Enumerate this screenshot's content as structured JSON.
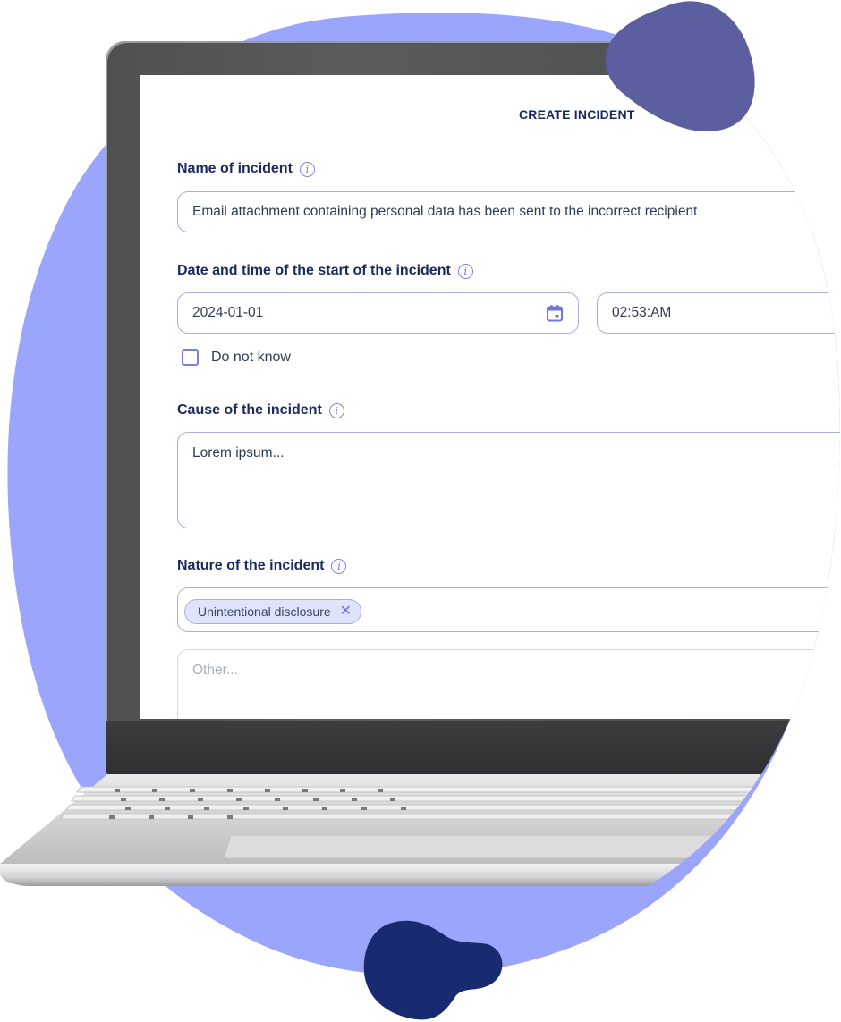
{
  "form": {
    "title": "CREATE INCIDENT",
    "name_field": {
      "label": "Name of incident",
      "value": "Email attachment containing personal data has been sent to the incorrect recipient"
    },
    "datetime_field": {
      "label": "Date and time of the start of the incident",
      "date_value": "2024-01-01",
      "time_value": "02:53:AM",
      "do_not_know_label": "Do not know",
      "do_not_know_checked": false
    },
    "cause_field": {
      "label": "Cause of the incident",
      "value": "Lorem ipsum..."
    },
    "nature_field": {
      "label": "Nature of the incident",
      "selected_tags": [
        "Unintentional disclosure"
      ],
      "other_placeholder": "Other..."
    }
  },
  "icons": {
    "info": "info-icon",
    "calendar": "calendar-icon",
    "remove_tag": "close-icon"
  },
  "colors": {
    "background_blob": "#9aa5fb",
    "top_blob": "#5b5f9f",
    "bottom_blob": "#182a70",
    "heading_text": "#1a2a5c",
    "field_border": "#a7aede",
    "accent": "#6f74d8",
    "chip_bg": "#dfe3fb"
  }
}
